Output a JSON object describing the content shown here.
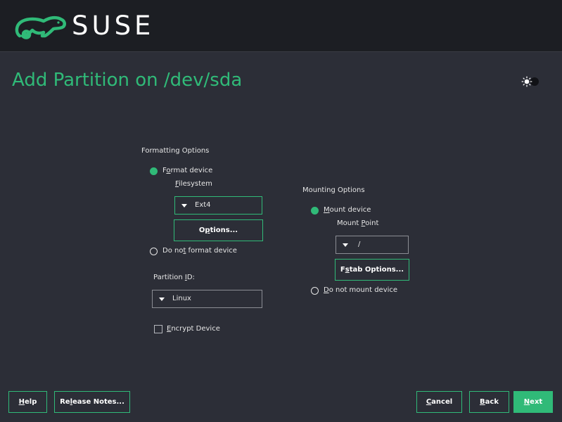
{
  "header": {
    "logo_text": "SUSE",
    "brand_color": "#30ba78",
    "background": "#1c1e23"
  },
  "page": {
    "title": "Add Partition on /dev/sda",
    "theme_toggle_icon": "sun-toggle-icon"
  },
  "formatting": {
    "section_label": "Formatting Options",
    "format_device": {
      "pre": "F",
      "underline": "o",
      "post": "rmat device",
      "selected": true
    },
    "filesystem_label": {
      "underline": "F",
      "post": "ilesystem"
    },
    "filesystem_value": "Ext4",
    "options_button": {
      "pre": "O",
      "underline": "p",
      "post": "tions..."
    },
    "do_not_format": {
      "pre": "Do no",
      "underline": "t",
      "post": " format device",
      "selected": false
    },
    "partition_id_label": {
      "pre": "Partition ",
      "underline": "I",
      "post": "D:"
    },
    "partition_id_value": "Linux",
    "encrypt_device": {
      "underline": "E",
      "post": "ncrypt Device",
      "checked": false
    }
  },
  "mounting": {
    "section_label": "Mounting Options",
    "mount_device": {
      "underline": "M",
      "post": "ount device",
      "selected": true
    },
    "mount_point_label": {
      "pre": "Mount ",
      "underline": "P",
      "post": "oint"
    },
    "mount_point_value": "/",
    "fstab_button": {
      "pre": "F",
      "underline": "s",
      "post": "tab Options..."
    },
    "do_not_mount": {
      "underline": "D",
      "post": "o not mount device",
      "selected": false
    }
  },
  "footer": {
    "help": {
      "underline": "H",
      "post": "elp"
    },
    "release_notes": {
      "pre": "Re",
      "underline": "l",
      "post": "ease Notes..."
    },
    "cancel": {
      "underline": "C",
      "post": "ancel"
    },
    "back": {
      "underline": "B",
      "post": "ack"
    },
    "next": {
      "underline": "N",
      "post": "ext"
    }
  }
}
